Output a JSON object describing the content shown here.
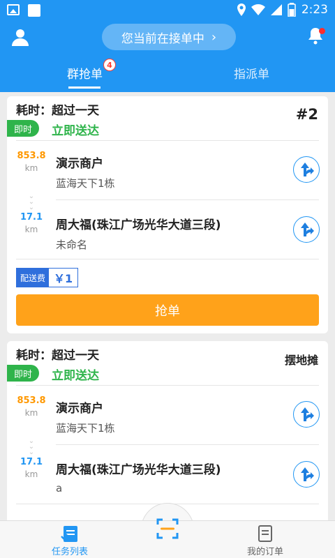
{
  "status_bar": {
    "time": "2:23"
  },
  "header": {
    "status_pill": "您当前在接单中",
    "tabs": [
      {
        "label": "群抢单",
        "badge": "4"
      },
      {
        "label": "指派单"
      }
    ]
  },
  "orders": [
    {
      "elapsed": "耗时：超过一天",
      "order_no": "#2",
      "type_badge": "即时",
      "delivery": "立即送达",
      "pickup": {
        "distance": "853.8",
        "unit": "km",
        "name": "演示商户",
        "address": "蓝海天下1栋"
      },
      "dropoff": {
        "distance": "17.1",
        "unit": "km",
        "name": "周大福(珠江广场光华大道三段)",
        "address": "未命名"
      },
      "fee_label": "配送费",
      "fee_value": "￥1",
      "grab_label": "抢单"
    },
    {
      "elapsed": "耗时：超过一天",
      "order_tag": "摆地摊",
      "type_badge": "即时",
      "delivery": "立即送达",
      "pickup": {
        "distance": "853.8",
        "unit": "km",
        "name": "演示商户",
        "address": "蓝海天下1栋"
      },
      "dropoff": {
        "distance": "17.1",
        "unit": "km",
        "name": "周大福(珠江广场光华大道三段)",
        "address": "a"
      }
    }
  ],
  "bottom_nav": {
    "left": "任务列表",
    "right": "我的订单"
  },
  "colors": {
    "primary": "#2196f3",
    "green": "#2fb44b",
    "orange": "#ff9800",
    "button": "#ffa21a"
  }
}
